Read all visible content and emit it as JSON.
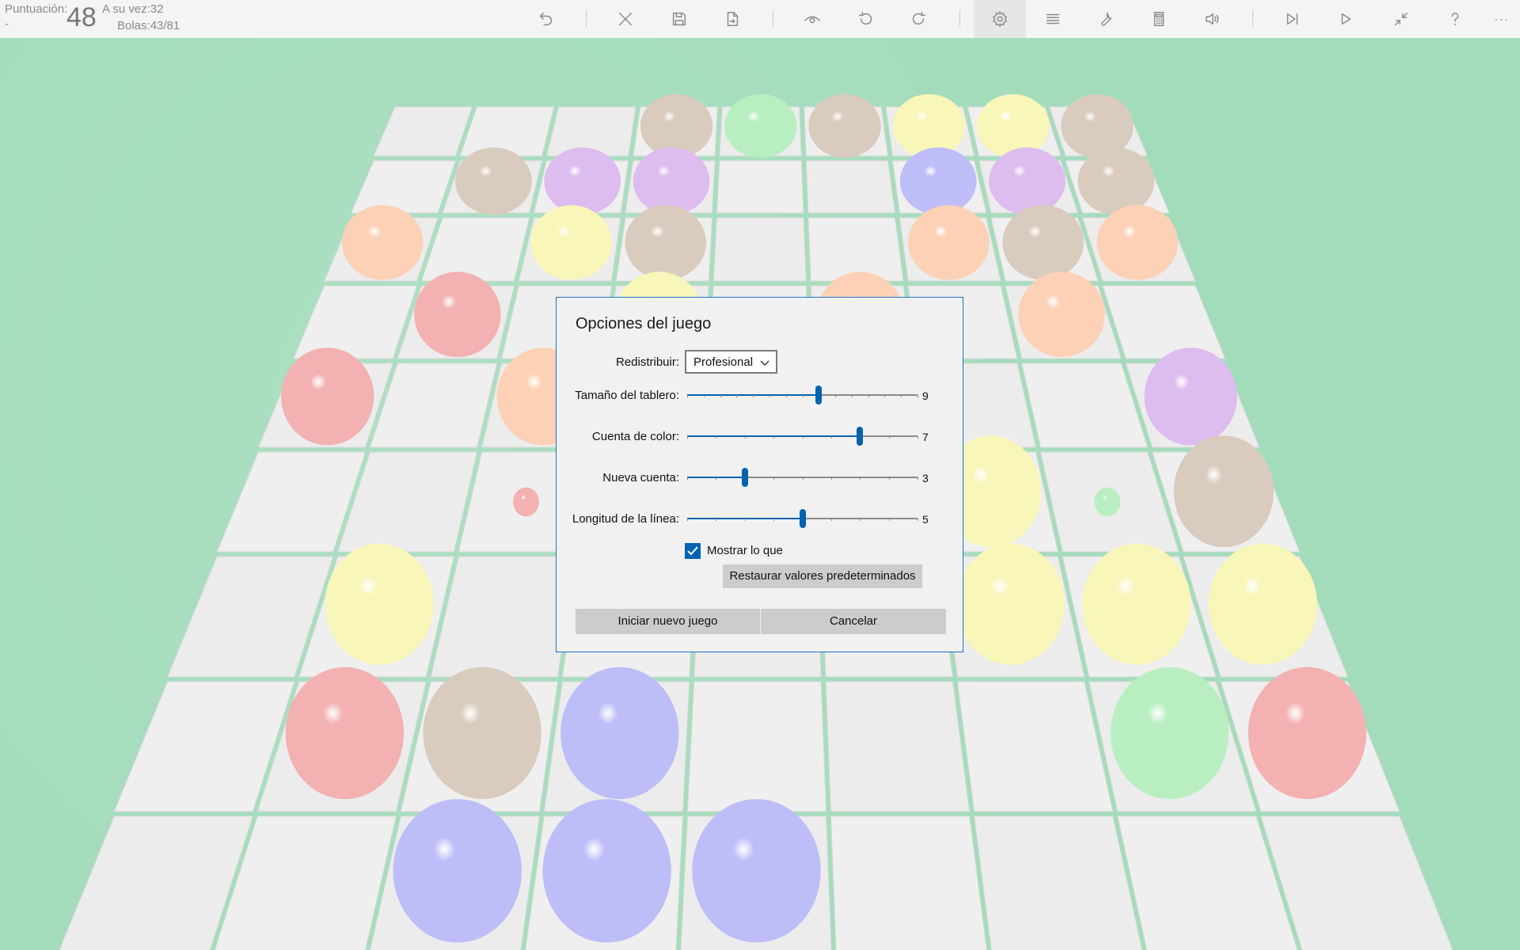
{
  "header": {
    "score_label": "Puntuación:",
    "score_dash": "-",
    "score_value": "48",
    "turn_text": "A su vez:32",
    "balls_text": "Bolas:43/81"
  },
  "toolbar": {
    "buttons": [
      "undo-icon",
      "close-icon",
      "save-icon",
      "export-icon",
      "eye-icon",
      "rotate-left-icon",
      "rotate-right-icon",
      "gear-icon",
      "list-icon",
      "wrench-icon",
      "calculator-icon",
      "volume-icon",
      "skip-icon",
      "play-icon",
      "collapse-icon",
      "help-icon",
      "more-icon"
    ]
  },
  "dialog": {
    "title": "Opciones del juego",
    "redistribute_label": "Redistribuir:",
    "redistribute_value": "Profesional",
    "sliders": [
      {
        "label": "Tamaño del tablero:",
        "value": 9,
        "min": 1,
        "max": 15
      },
      {
        "label": "Cuenta de color:",
        "value": 7,
        "min": 1,
        "max": 9
      },
      {
        "label": "Nueva cuenta:",
        "value": 3,
        "min": 1,
        "max": 9
      },
      {
        "label": "Longitud de la línea:",
        "value": 5,
        "min": 1,
        "max": 9
      }
    ],
    "checkbox_label": "Mostrar lo que",
    "checkbox_checked": true,
    "restore_label": "Restaurar valores predeterminados",
    "new_game_label": "Iniciar nuevo juego",
    "cancel_label": "Cancelar"
  },
  "colors": {
    "accent": "#0063b1",
    "background": "#a3dcbb",
    "board_tile": "#eeeeee"
  },
  "balls": [
    {
      "row": 0,
      "col": 3,
      "color": "tan"
    },
    {
      "row": 0,
      "col": 4,
      "color": "green"
    },
    {
      "row": 0,
      "col": 5,
      "color": "tan"
    },
    {
      "row": 0,
      "col": 6,
      "color": "yellow"
    },
    {
      "row": 0,
      "col": 7,
      "color": "yellow"
    },
    {
      "row": 0,
      "col": 8,
      "color": "tan"
    },
    {
      "row": 1,
      "col": 1,
      "color": "tan"
    },
    {
      "row": 1,
      "col": 2,
      "color": "purple"
    },
    {
      "row": 1,
      "col": 3,
      "color": "purple"
    },
    {
      "row": 1,
      "col": 6,
      "color": "blue"
    },
    {
      "row": 1,
      "col": 7,
      "color": "purple"
    },
    {
      "row": 1,
      "col": 8,
      "color": "tan"
    },
    {
      "row": 2,
      "col": 0,
      "color": "peach"
    },
    {
      "row": 2,
      "col": 2,
      "color": "yellow"
    },
    {
      "row": 2,
      "col": 3,
      "color": "tan"
    },
    {
      "row": 2,
      "col": 6,
      "color": "peach"
    },
    {
      "row": 2,
      "col": 7,
      "color": "tan"
    },
    {
      "row": 2,
      "col": 8,
      "color": "peach"
    },
    {
      "row": 3,
      "col": 1,
      "color": "red"
    },
    {
      "row": 3,
      "col": 3,
      "color": "yellow"
    },
    {
      "row": 3,
      "col": 5,
      "color": "peach"
    },
    {
      "row": 3,
      "col": 7,
      "color": "peach"
    },
    {
      "row": 4,
      "col": 0,
      "color": "red"
    },
    {
      "row": 4,
      "col": 2,
      "color": "peach"
    },
    {
      "row": 4,
      "col": 8,
      "color": "purple"
    },
    {
      "row": 5,
      "col": 6,
      "color": "yellow"
    },
    {
      "row": 5,
      "col": 8,
      "color": "tan"
    },
    {
      "row": 6,
      "col": 1,
      "color": "yellow"
    },
    {
      "row": 6,
      "col": 6,
      "color": "yellow"
    },
    {
      "row": 6,
      "col": 7,
      "color": "yellow"
    },
    {
      "row": 6,
      "col": 8,
      "color": "yellow"
    },
    {
      "row": 7,
      "col": 1,
      "color": "red"
    },
    {
      "row": 7,
      "col": 2,
      "color": "tan"
    },
    {
      "row": 7,
      "col": 3,
      "color": "blue"
    },
    {
      "row": 7,
      "col": 7,
      "color": "green"
    },
    {
      "row": 7,
      "col": 8,
      "color": "red"
    },
    {
      "row": 8,
      "col": 2,
      "color": "blue"
    },
    {
      "row": 8,
      "col": 3,
      "color": "blue"
    },
    {
      "row": 8,
      "col": 4,
      "color": "blue"
    }
  ],
  "preview_balls": [
    {
      "row": 3,
      "col": 4,
      "color": "purple"
    },
    {
      "row": 5,
      "col": 2,
      "color": "red"
    },
    {
      "row": 5,
      "col": 7,
      "color": "green"
    }
  ],
  "ball_colors": {
    "tan": "#d9cbbd",
    "green": "#b9efc0",
    "yellow": "#f8f6b9",
    "purple": "#ddbcef",
    "blue": "#bdbdf8",
    "peach": "#fcd1b6",
    "red": "#f3b1b1"
  }
}
